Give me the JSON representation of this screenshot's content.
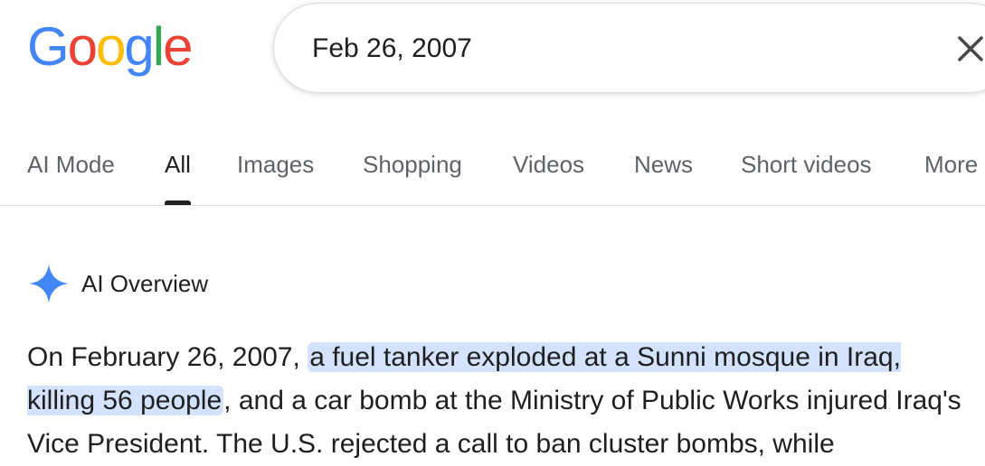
{
  "logo": {
    "letters": [
      "G",
      "o",
      "o",
      "g",
      "l",
      "e"
    ],
    "colors": [
      "#4285F4",
      "#EA4335",
      "#FBBC05",
      "#4285F4",
      "#34A853",
      "#EA4335"
    ]
  },
  "search": {
    "query": "Feb 26, 2007",
    "clear_icon": "close-icon"
  },
  "tabs": [
    {
      "label": "AI Mode",
      "active": false
    },
    {
      "label": "All",
      "active": true
    },
    {
      "label": "Images",
      "active": false
    },
    {
      "label": "Shopping",
      "active": false
    },
    {
      "label": "Videos",
      "active": false
    },
    {
      "label": "News",
      "active": false
    },
    {
      "label": "Short videos",
      "active": false
    },
    {
      "label": "More",
      "active": false
    }
  ],
  "ai_overview": {
    "icon": "sparkle-icon",
    "icon_color": "#4285F4",
    "title": "AI Overview",
    "text_before": "On February 26, 2007, ",
    "highlighted": "a fuel tanker exploded at a Sunni mosque in Iraq, killing 56 people",
    "text_after": ", and a car bomb at the Ministry of Public Works injured Iraq's Vice President. The U.S. rejected a call to ban cluster bombs, while",
    "highlight_color": "#d3e3fd"
  }
}
